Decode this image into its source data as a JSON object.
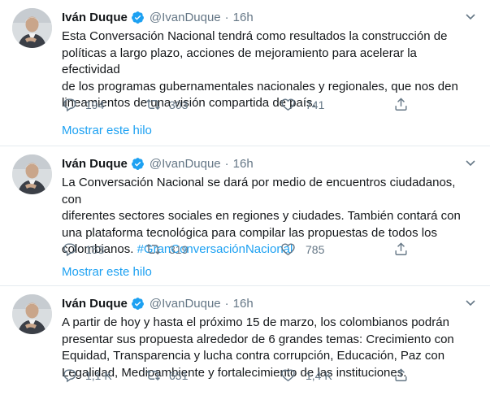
{
  "tweets": [
    {
      "author_name": "Iván Duque",
      "handle": "@IvanDuque",
      "separator": "·",
      "time": "16h",
      "text_lines": [
        "Esta Conversación Nacional tendrá como resultados la construcción de",
        "políticas a largo plazo, acciones de mejoramiento para acelerar la efectividad",
        "de los programas gubernamentales nacionales y regionales, que nos den",
        "lineamientos de una visión compartida de país."
      ],
      "hashtag": "",
      "replies": "194",
      "retweets": "303",
      "likes": "741",
      "thread_link": "Mostrar este hilo"
    },
    {
      "author_name": "Iván Duque",
      "handle": "@IvanDuque",
      "separator": "·",
      "time": "16h",
      "text_lines": [
        "La Conversación Nacional se dará por medio de encuentros ciudadanos, con",
        "diferentes sectores sociales en regiones y ciudades. También contará con",
        "una plataforma tecnológica para compilar las propuestas de todos los",
        "colombianos."
      ],
      "hashtag": "#GranConversaciónNacional",
      "replies": "153",
      "retweets": "319",
      "likes": "785",
      "thread_link": "Mostrar este hilo"
    },
    {
      "author_name": "Iván Duque",
      "handle": "@IvanDuque",
      "separator": "·",
      "time": "16h",
      "text_lines": [
        "A partir de hoy y hasta el próximo 15 de marzo, los colombianos podrán",
        "presentar sus propuesta alrededor de 6 grandes temas: Crecimiento con",
        "Equidad, Transparencia y lucha contra corrupción, Educación, Paz con",
        "Legalidad, Medioambiente y fortalecimiento de las instituciones."
      ],
      "hashtag": "",
      "replies": "1,1 K",
      "retweets": "651",
      "likes": "1,4 K",
      "thread_link": ""
    }
  ],
  "icons": {
    "verified": "verified-badge-icon",
    "caret": "chevron-down-icon",
    "reply": "reply-icon",
    "retweet": "retweet-icon",
    "like": "heart-icon",
    "share": "share-icon"
  },
  "colors": {
    "link": "#1da1f2",
    "muted": "#657786",
    "text": "#14171a",
    "divider": "#e6ecf0"
  }
}
